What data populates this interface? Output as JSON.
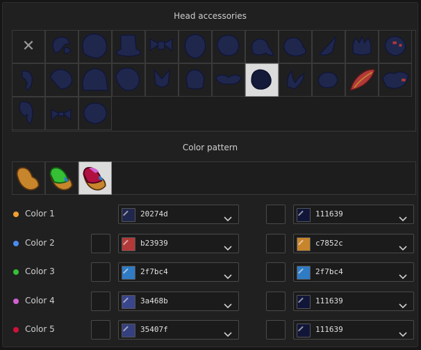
{
  "head_accessories": {
    "title": "Head accessories",
    "none_glyph": "✕",
    "items": [
      {
        "icon": "none-icon"
      },
      {
        "icon": "bow-helmet-icon"
      },
      {
        "icon": "big-hood-icon"
      },
      {
        "icon": "top-hat-icon"
      },
      {
        "icon": "ribbon-bow-icon"
      },
      {
        "icon": "hair-cap-icon"
      },
      {
        "icon": "round-cap-icon"
      },
      {
        "icon": "beanie-tassel-icon"
      },
      {
        "icon": "bun-hat-icon"
      },
      {
        "icon": "cone-horn-icon"
      },
      {
        "icon": "crown-icon"
      },
      {
        "icon": "spiky-hat-icon"
      },
      {
        "icon": "hook-hair-icon"
      },
      {
        "icon": "side-cap-icon"
      },
      {
        "icon": "wide-hood-icon"
      },
      {
        "icon": "large-cap-icon"
      },
      {
        "icon": "pointy-ears-icon"
      },
      {
        "icon": "knight-helm-icon"
      },
      {
        "icon": "goggles-icon"
      },
      {
        "icon": "bandana-icon",
        "selected": true
      },
      {
        "icon": "leaf-sprout-icon"
      },
      {
        "icon": "bean-cap-icon"
      },
      {
        "icon": "feather-icon"
      },
      {
        "icon": "jester-hat-icon"
      },
      {
        "icon": "long-hair-icon"
      },
      {
        "icon": "small-bow-icon"
      },
      {
        "icon": "mushroom-cap-icon"
      }
    ]
  },
  "color_pattern": {
    "title": "Color pattern",
    "items": [
      {
        "icon": "pattern-1-icon"
      },
      {
        "icon": "pattern-2-icon"
      },
      {
        "icon": "pattern-3-icon",
        "selected": true
      }
    ]
  },
  "colors": [
    {
      "label": "Color 1",
      "dot": "#f0a030",
      "left_check": false,
      "left_hex": "20274d",
      "left_color": "#20274d",
      "right_hex": "111639",
      "right_color": "#111639"
    },
    {
      "label": "Color 2",
      "dot": "#4a8cf0",
      "left_check": true,
      "left_hex": "b23939",
      "left_color": "#b23939",
      "right_hex": "c7852c",
      "right_color": "#c7852c"
    },
    {
      "label": "Color 3",
      "dot": "#35c035",
      "left_check": true,
      "left_hex": "2f7bc4",
      "left_color": "#2f7bc4",
      "right_hex": "2f7bc4",
      "right_color": "#2f7bc4"
    },
    {
      "label": "Color 4",
      "dot": "#d060d0",
      "left_check": true,
      "left_hex": "3a468b",
      "left_color": "#3a468b",
      "right_hex": "111639",
      "right_color": "#111639"
    },
    {
      "label": "Color 5",
      "dot": "#d0103a",
      "left_check": true,
      "left_hex": "35407f",
      "left_color": "#35407f",
      "right_hex": "111639",
      "right_color": "#111639"
    }
  ],
  "palette": {
    "accessory_fill": "#20274d",
    "accessory_outline": "#111639",
    "accent_red": "#b23939",
    "accent_orange": "#c7852c"
  }
}
